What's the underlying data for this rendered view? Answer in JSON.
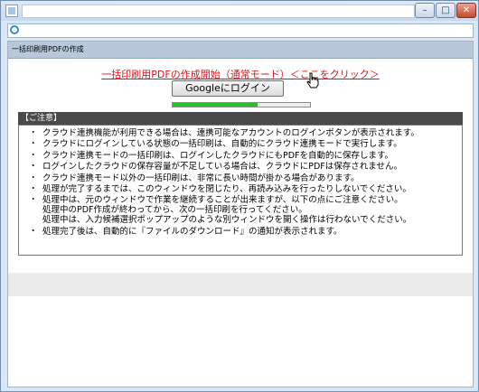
{
  "page": {
    "section_title": "一括印刷用PDFの作成",
    "start_link": "一括印刷用PDFの作成開始（通常モード）＜ここをクリック＞",
    "google_login_button": "Googleにログイン",
    "progress": 0.62
  },
  "notice": {
    "header": "【ご注意】",
    "items": [
      {
        "lines": [
          "クラウド連携機能が利用できる場合は、連携可能なアカウントのログインボタンが表示されます。"
        ]
      },
      {
        "lines": [
          "クラウドにログインしている状態の一括印刷は、自動的にクラウド連携モードで実行します。"
        ]
      },
      {
        "lines": [
          "クラウド連携モードの一括印刷は、ログインしたクラウドにもPDFを自動的に保存します。"
        ]
      },
      {
        "lines": [
          "ログインしたクラウドの保存容量が不足している場合は、クラウドにPDFは保存されません。"
        ]
      },
      {
        "lines": [
          "クラウド連携モード以外の一括印刷は、非常に長い時間が掛かる場合があります。"
        ]
      },
      {
        "lines": [
          "処理が完了するまでは、このウィンドウを閉じたり、再読み込みを行ったりしないでください。"
        ]
      },
      {
        "lines": [
          "処理中は、元のウィンドウで作業を継続することが出来ますが、以下の点にご注意ください。",
          "処理中のPDF作成が終わってから、次の一括印刷を行ってください。",
          "処理中は、入力候補選択ポップアップのような別ウィンドウを開く操作は行わないでください。"
        ]
      },
      {
        "lines": [
          "処理完了後は、自動的に『ファイルのダウンロード』の通知が表示されます。"
        ]
      }
    ]
  },
  "window": {
    "minimize_glyph": "–",
    "maximize_glyph": "□",
    "close_glyph": "✕"
  },
  "colors": {
    "link": "#e0131a",
    "progress_fill": "#2bc02b",
    "notice_header_bg": "#4a4a4a"
  },
  "icons": [
    "app-icon",
    "ie-icon",
    "hand-cursor-icon"
  ]
}
